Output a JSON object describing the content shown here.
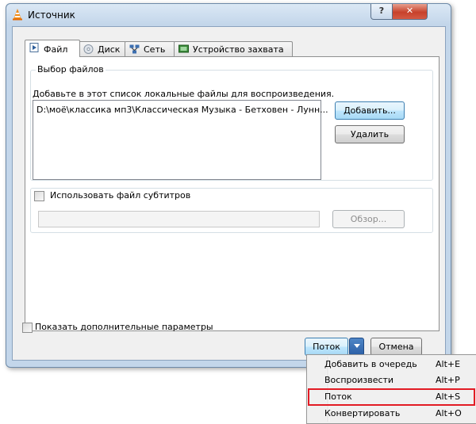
{
  "window": {
    "title": "Источник",
    "help_glyph": "?",
    "close_glyph": "✕"
  },
  "tabs": [
    {
      "label": "Файл",
      "icon": "file-icon",
      "active": true
    },
    {
      "label": "Диск",
      "icon": "disc-icon",
      "active": false
    },
    {
      "label": "Сеть",
      "icon": "network-icon",
      "active": false
    },
    {
      "label": "Устройство захвата",
      "icon": "capture-device-icon",
      "active": false
    }
  ],
  "file_selection": {
    "group_title": "Выбор файлов",
    "hint": "Добавьте в этот список локальные файлы для воспроизведения.",
    "files": [
      "D:\\моё\\классика мп3\\Классическая Музыка - Бетховен - Лунн..."
    ],
    "add_button": "Добавить...",
    "remove_button": "Удалить"
  },
  "subtitles": {
    "checkbox_label": "Использовать файл субтитров",
    "checked": false,
    "browse_button": "Обзор..."
  },
  "advanced": {
    "checkbox_label": "Показать дополнительные параметры",
    "checked": false
  },
  "footer": {
    "stream_button": "Поток",
    "cancel_button": "Отмена"
  },
  "menu": [
    {
      "label": "Добавить в очередь",
      "shortcut": "Alt+E"
    },
    {
      "label": "Воспроизвести",
      "shortcut": "Alt+P"
    },
    {
      "label": "Поток",
      "shortcut": "Alt+S",
      "highlighted": true
    },
    {
      "label": "Конвертировать",
      "shortcut": "Alt+O"
    }
  ],
  "colors": {
    "window_frame": "#c3d6ea",
    "highlight_box": "#e21b24",
    "close_button": "#c7412b",
    "dropdown_button": "#2b5fa6"
  }
}
